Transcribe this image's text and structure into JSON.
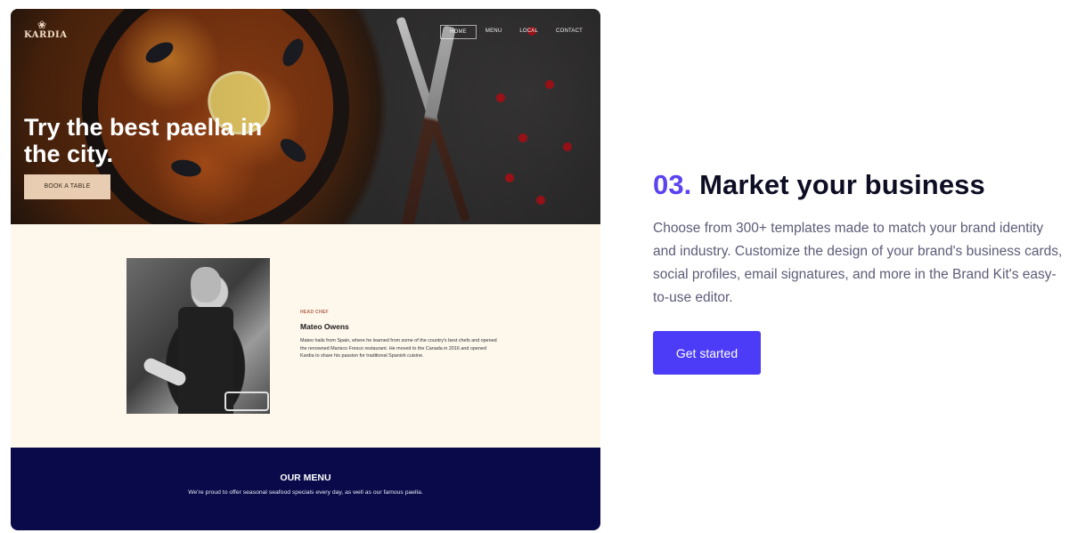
{
  "mockup": {
    "brand": {
      "logo_text": "KARDIA",
      "logo_glyph": "fish-icon"
    },
    "nav": [
      {
        "label": "HOME",
        "active": true
      },
      {
        "label": "MENU",
        "active": false
      },
      {
        "label": "LOCAL",
        "active": false
      },
      {
        "label": "CONTACT",
        "active": false
      }
    ],
    "hero": {
      "title": "Try the best paella in the city.",
      "button_label": "BOOK A TABLE"
    },
    "chef": {
      "label": "HEAD CHEF",
      "name": "Mateo Owens",
      "bio": "Mateo hails from Spain, where he learned from some of the country's best chefs and opened the renowned Marisco Fresco restaurant. He moved to the Canada in 2016 and opened Kardia to share his passion for traditional Spanish cuisine."
    },
    "menu": {
      "title": "OUR MENU",
      "subtitle": "We're proud to offer seasonal seafood specials every day, as well as our famous paella."
    }
  },
  "feature": {
    "number": "03.",
    "title": "Market your business",
    "description": "Choose from 300+ templates made to match your brand identity and industry. Customize the design of your brand's business cards, social profiles, email signatures, and more in the Brand Kit's easy-to-use editor.",
    "cta_label": "Get started"
  },
  "colors": {
    "accent": "#4c3cf7",
    "step_number": "#5a43f0",
    "menu_bg": "#0a0a4a",
    "chef_bg": "#fdf7ec",
    "hero_button": "#e8cdb3"
  }
}
